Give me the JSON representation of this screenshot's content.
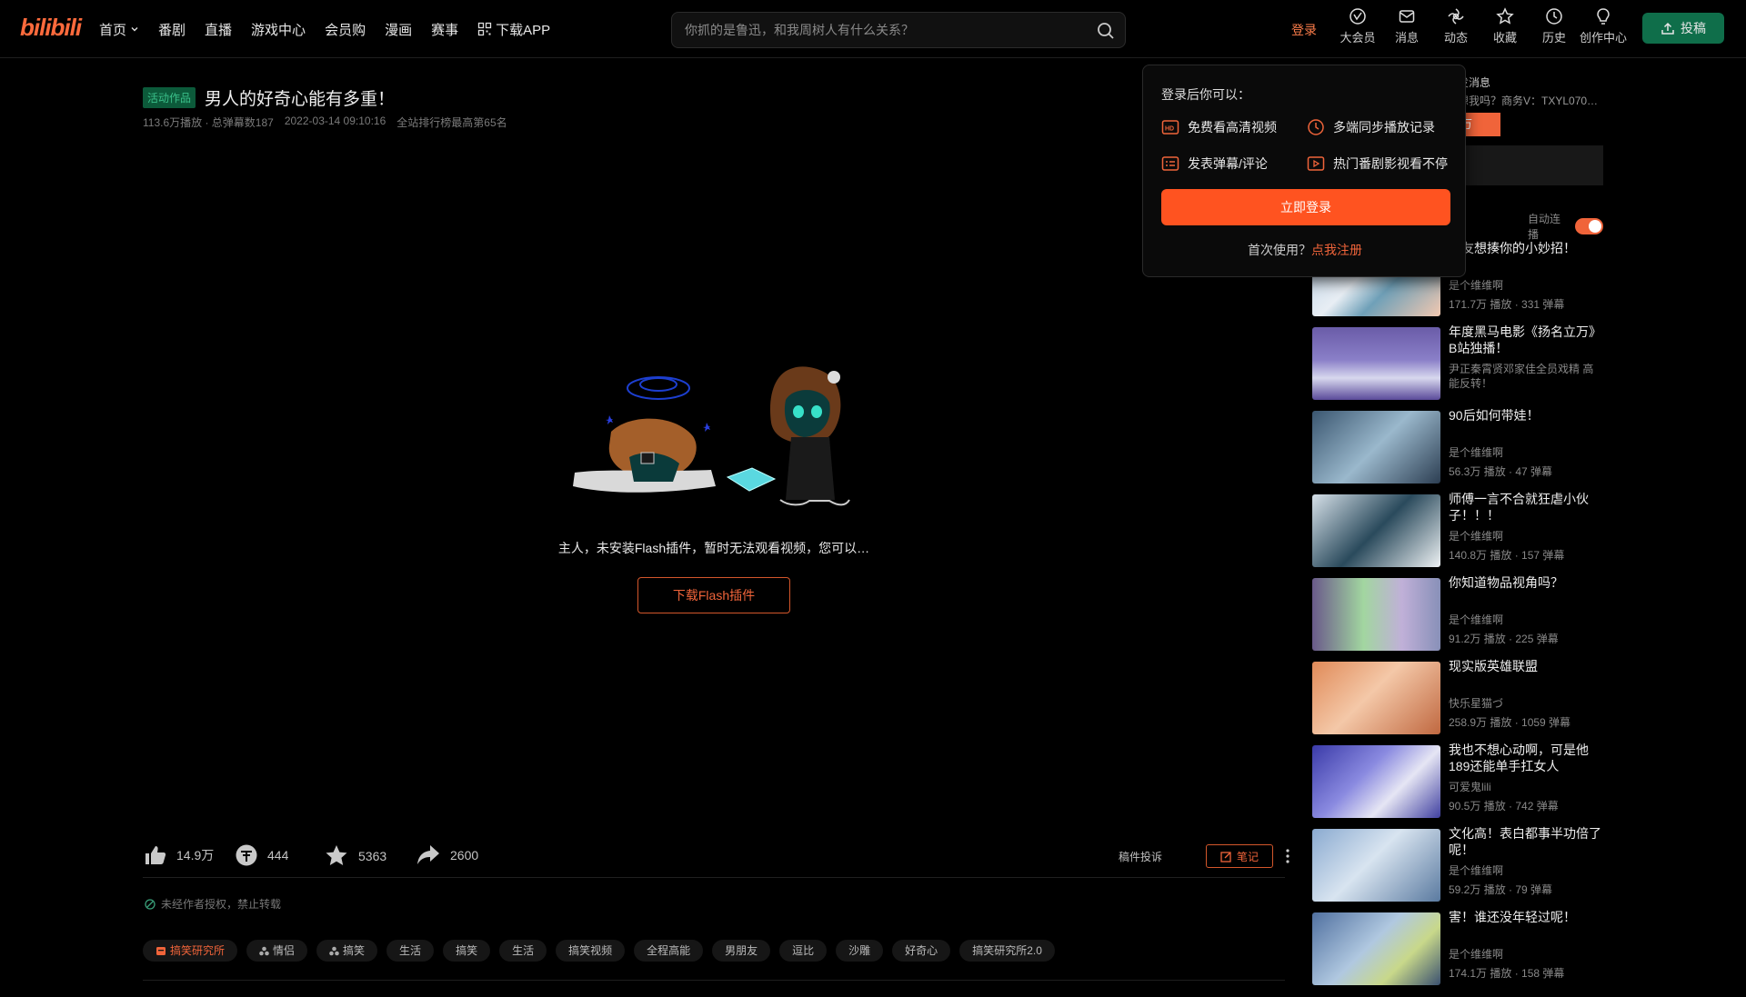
{
  "header": {
    "logo": "bilibili",
    "nav": [
      {
        "label": "首页"
      },
      {
        "label": "番剧"
      },
      {
        "label": "直播"
      },
      {
        "label": "游戏中心"
      },
      {
        "label": "会员购"
      },
      {
        "label": "漫画"
      },
      {
        "label": "赛事"
      },
      {
        "label": "下载APP"
      }
    ],
    "search_placeholder": "你抓的是鲁迅，和我周树人有什么关系？",
    "login": "登录",
    "right_icons": [
      {
        "label": "大会员",
        "icon": "vip-icon"
      },
      {
        "label": "消息",
        "icon": "message-icon"
      },
      {
        "label": "动态",
        "icon": "dynamic-icon"
      },
      {
        "label": "收藏",
        "icon": "star-icon"
      },
      {
        "label": "历史",
        "icon": "clock-icon"
      },
      {
        "label": "创作中心",
        "icon": "bulb-icon"
      }
    ],
    "upload": "投稿"
  },
  "video": {
    "badge": "活动作品",
    "title": "男人的好奇心能有多重！",
    "meta": {
      "plays": "113.6万播放 · 总弹幕数187",
      "date": "2022-03-14 09:10:16",
      "rank": "全站排行榜最高第65名"
    }
  },
  "player": {
    "message": "主人，未安装Flash插件，暂时无法观看视频，您可以…",
    "download_btn": "下载Flash插件"
  },
  "toolbar": {
    "like": "14.9万",
    "coin": "444",
    "fav": "5363",
    "share": "2600",
    "complaint": "稿件投诉",
    "note": "笔记"
  },
  "copyright": "未经作者授权，禁止转载",
  "tags": [
    "搞笑研究所",
    "情侣",
    "搞笑",
    "生活",
    "搞笑",
    "生活",
    "搞笑视频",
    "全程高能",
    "男朋友",
    "逗比",
    "沙雕",
    "好奇心",
    "搞笑研究所2.0"
  ],
  "sidebar": {
    "ad_line1": "发消息",
    "ad_line2": "想我吗？商务V：TXYL070…",
    "ad_orange": "万",
    "autoplay": "自动连播",
    "recommendations": [
      {
        "title": "朋友想揍你的小妙招！",
        "author": "是个维维啊",
        "stats": "171.7万 播放 · 331 弹幕"
      },
      {
        "title": "年度黑马电影《扬名立万》B站独播！",
        "author": "尹正秦霄贤邓家佳全员戏精 高能反转！",
        "stats": ""
      },
      {
        "title": "90后如何带娃！",
        "author": "是个维维啊",
        "stats": "56.3万 播放 · 47 弹幕"
      },
      {
        "title": "师傅一言不合就狂虐小伙子！！！",
        "author": "是个维维啊",
        "stats": "140.8万 播放 · 157 弹幕"
      },
      {
        "title": "你知道物品视角吗？",
        "author": "是个维维啊",
        "stats": "91.2万 播放 · 225 弹幕"
      },
      {
        "title": "现实版英雄联盟",
        "author": "快乐星猫づ",
        "stats": "258.9万 播放 · 1059 弹幕"
      },
      {
        "title": "我也不想心动啊，可是他189还能单手扛女人",
        "author": "可爱鬼lili",
        "stats": "90.5万 播放 · 742 弹幕"
      },
      {
        "title": "文化高！表白都事半功倍了呢！",
        "author": "是个维维啊",
        "stats": "59.2万 播放 · 79 弹幕"
      },
      {
        "title": "害！谁还没年轻过呢！",
        "author": "是个维维啊",
        "stats": "174.1万 播放 · 158 弹幕"
      }
    ]
  },
  "login_popover": {
    "title": "登录后你可以：",
    "features": [
      "免费看高清视频",
      "多端同步播放记录",
      "发表弹幕/评论",
      "热门番剧影视看不停"
    ],
    "login_btn": "立即登录",
    "register_prefix": "首次使用？",
    "register_link": "点我注册"
  },
  "colors": {
    "accent": "#f0643a",
    "upload_btn": "#0f6e4a",
    "bg": "#000000"
  }
}
